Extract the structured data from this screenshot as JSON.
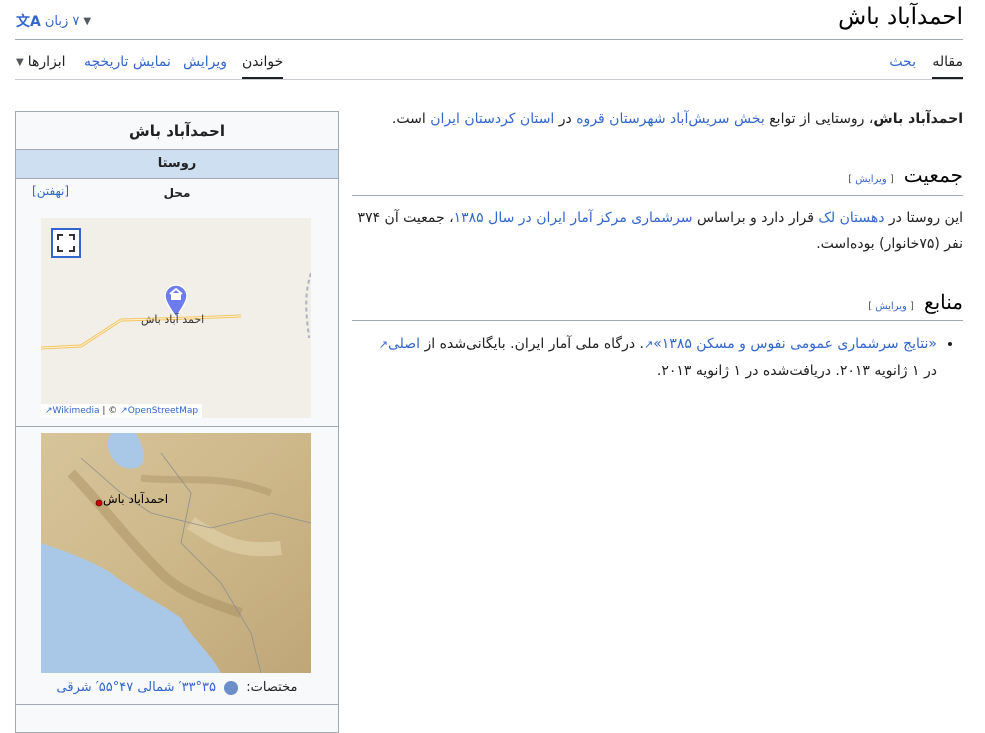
{
  "header": {
    "title": "احمدآباد باش",
    "languages_label": "۷ زبان"
  },
  "tabs": {
    "article": "مقاله",
    "talk": "بحث",
    "read": "خواندن",
    "edit": "ویرایش",
    "history": "نمایش تاریخچه",
    "tools": "ابزارها"
  },
  "intro": {
    "bold": "احمدآباد باش",
    "t1": "، روستایی از توابع ",
    "l1": "بخش سریش‌آباد",
    "t2": " ",
    "l2": "شهرستان قروه",
    "t3": " در ",
    "l3": "استان کردستان",
    "t4": " ",
    "l4": "ایران",
    "t5": " است."
  },
  "population": {
    "heading": "جمعیت",
    "edit": "ویرایش",
    "t1": "این روستا در ",
    "l1": "دهستان لک",
    "t2": " قرار دارد و براساس ",
    "l2": "سرشماری مرکز آمار ایران در سال ۱۳۸۵",
    "t3": "، جمعیت آن ۳۷۴ نفر (۷۵خانوار) بوده‌است."
  },
  "sources": {
    "heading": "منابع",
    "edit": "ویرایش",
    "l1": "«نتایج سرشماری عمومی نفوس و مسکن ۱۳۸۵»",
    "t1": ". درگاه ملی آمار ایران. بایگانی‌شده از ",
    "l2": "اصلی",
    "t2": " در ۱ ژانویه ۲۰۱۳. دریافت‌شده در ۱ ژانویه ۲۰۱۳."
  },
  "infobox": {
    "title": "احمدآباد باش",
    "type": "روستا",
    "location": "محل",
    "hide": "[نهفتن]",
    "map1_label": "احمد آباد باش",
    "map1_attr_wikimedia": "Wikimedia",
    "map1_attr_sep": "| ©",
    "map1_attr_osm": "OpenStreetMap",
    "map2_label": "احمدآباد باش",
    "coords_label": "مختصات:",
    "coords_value": "۳۵°۳۳′ شمالی ۴۷°۵۵′ شرقی"
  },
  "colors": {
    "link": "#3366cc",
    "infobox_header": "#cedff2",
    "map_pin": "#6c7cf0"
  },
  "icons": {
    "translate": "translate-icon",
    "chevron": "chevron-down-icon",
    "fullscreen": "fullscreen-icon",
    "pin": "map-pin-icon",
    "globe": "globe-icon",
    "external": "external-link-icon"
  }
}
